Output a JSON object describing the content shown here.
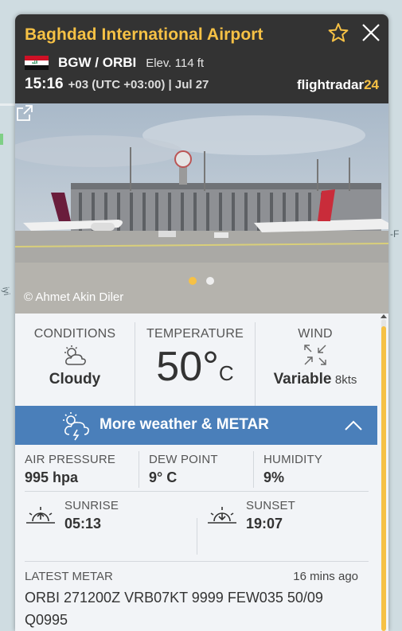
{
  "map": {
    "labels": [
      "-F",
      "iyi"
    ]
  },
  "airport": {
    "name": "Baghdad International Airport",
    "codes": "BGW / ORBI",
    "elevation": "Elev. 114 ft",
    "local_time": "15:16",
    "timezone": "+03 (UTC +03:00) | Jul 27",
    "brand_main": "flightradar",
    "brand_num": "24",
    "flag": "iraq-flag"
  },
  "photo": {
    "credit": "© Ahmet Akin Diler",
    "slides_total": 2,
    "active_slide": 1
  },
  "conditions": {
    "conditions_label": "CONDITIONS",
    "conditions_value": "Cloudy",
    "temperature_label": "TEMPERATURE",
    "temperature_value": "50°",
    "temperature_unit": "C",
    "wind_label": "WIND",
    "wind_value": "Variable",
    "wind_speed": "8kts"
  },
  "more_weather": {
    "label": "More weather & METAR",
    "expanded": true
  },
  "details": {
    "pressure_label": "AIR PRESSURE",
    "pressure_value": "995 hpa",
    "dew_label": "DEW POINT",
    "dew_value": "9° C",
    "humidity_label": "HUMIDITY",
    "humidity_value": "9%",
    "sunrise_label": "SUNRISE",
    "sunrise_value": "05:13",
    "sunset_label": "SUNSET",
    "sunset_value": "19:07",
    "metar_label": "LATEST METAR",
    "metar_age": "16 mins ago",
    "metar_text": "ORBI 271200Z VRB07KT 9999 FEW035 50/09 Q0995"
  },
  "colors": {
    "accent": "#f6c145",
    "header_bg": "#333333",
    "button_blue": "#4a7fba"
  }
}
